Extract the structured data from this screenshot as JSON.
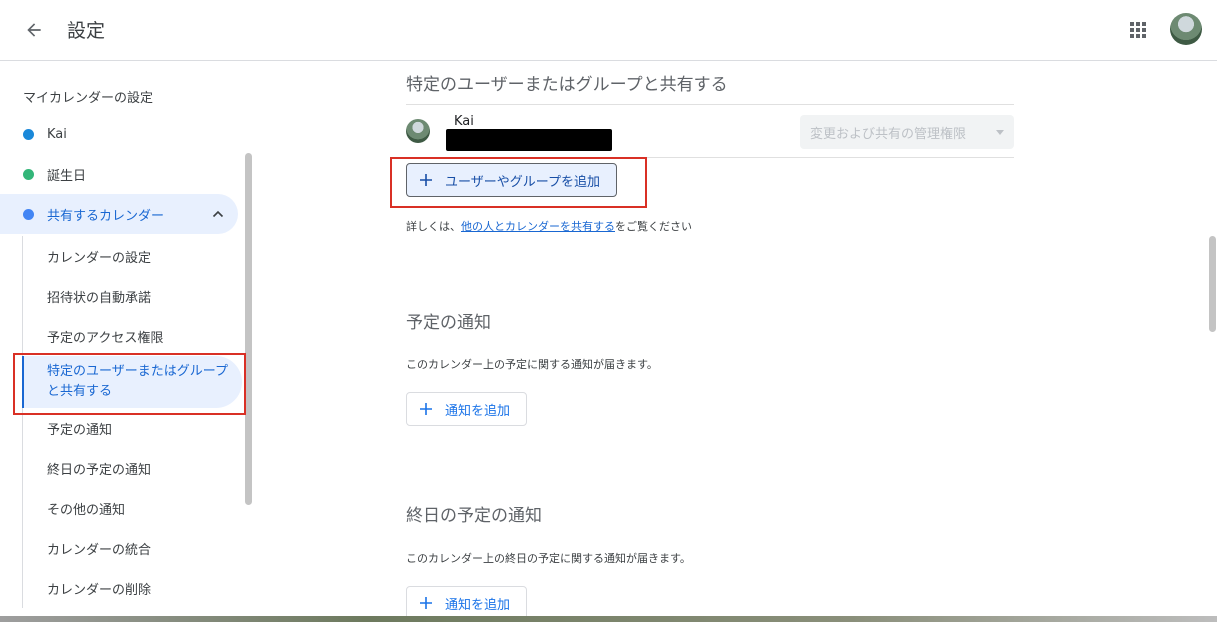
{
  "header": {
    "title": "設定"
  },
  "sidebar": {
    "heading": "マイカレンダーの設定",
    "calendars": [
      {
        "label": "Kai",
        "color": "#1a88d9"
      },
      {
        "label": "誕生日",
        "color": "#33b679"
      },
      {
        "label": "共有するカレンダー",
        "color": "#4285f4"
      }
    ],
    "sub_items": [
      "カレンダーの設定",
      "招待状の自動承諾",
      "予定のアクセス権限",
      "特定のユーザーまたはグループと共有する",
      "予定の通知",
      "終日の予定の通知",
      "その他の通知",
      "カレンダーの統合",
      "カレンダーの削除"
    ]
  },
  "share_section": {
    "title": "特定のユーザーまたはグループと共有する",
    "user_name": "Kai",
    "permission_value": "変更および共有の管理権限",
    "add_button": "ユーザーやグループを追加",
    "help_prefix": "詳しくは、",
    "help_link": "他の人とカレンダーを共有する",
    "help_suffix": "をご覧ください"
  },
  "event_notifications": {
    "title": "予定の通知",
    "desc": "このカレンダー上の予定に関する通知が届きます。",
    "add_button": "通知を追加"
  },
  "allday_notifications": {
    "title": "終日の予定の通知",
    "desc": "このカレンダー上の終日の予定に関する通知が届きます。",
    "add_button": "通知を追加"
  }
}
